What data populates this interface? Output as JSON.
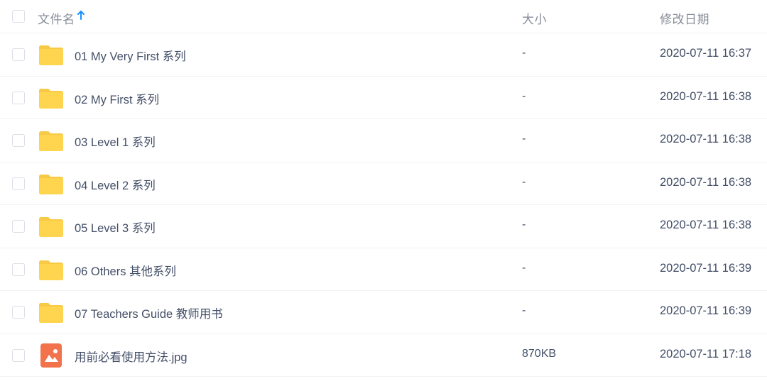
{
  "header": {
    "name_label": "文件名",
    "size_label": "大小",
    "date_label": "修改日期",
    "sort_icon": "arrow-up-icon",
    "sort_color": "#1890ff"
  },
  "colors": {
    "folder": "#ffd54f",
    "image_file": "#f2724b"
  },
  "files": [
    {
      "type": "folder",
      "icon": "folder-icon",
      "name": "01 My Very First 系列",
      "size": "-",
      "modified": "2020-07-11 16:37"
    },
    {
      "type": "folder",
      "icon": "folder-icon",
      "name": "02 My First 系列",
      "size": "-",
      "modified": "2020-07-11 16:38"
    },
    {
      "type": "folder",
      "icon": "folder-icon",
      "name": "03 Level 1 系列",
      "size": "-",
      "modified": "2020-07-11 16:38"
    },
    {
      "type": "folder",
      "icon": "folder-icon",
      "name": "04 Level 2 系列",
      "size": "-",
      "modified": "2020-07-11 16:38"
    },
    {
      "type": "folder",
      "icon": "folder-icon",
      "name": "05 Level 3 系列",
      "size": "-",
      "modified": "2020-07-11 16:38"
    },
    {
      "type": "folder",
      "icon": "folder-icon",
      "name": "06 Others 其他系列",
      "size": "-",
      "modified": "2020-07-11 16:39"
    },
    {
      "type": "folder",
      "icon": "folder-icon",
      "name": "07 Teachers Guide 教师用书",
      "size": "-",
      "modified": "2020-07-11 16:39"
    },
    {
      "type": "image",
      "icon": "image-file-icon",
      "name": "用前必看使用方法.jpg",
      "size": "870KB",
      "modified": "2020-07-11 17:18"
    }
  ]
}
